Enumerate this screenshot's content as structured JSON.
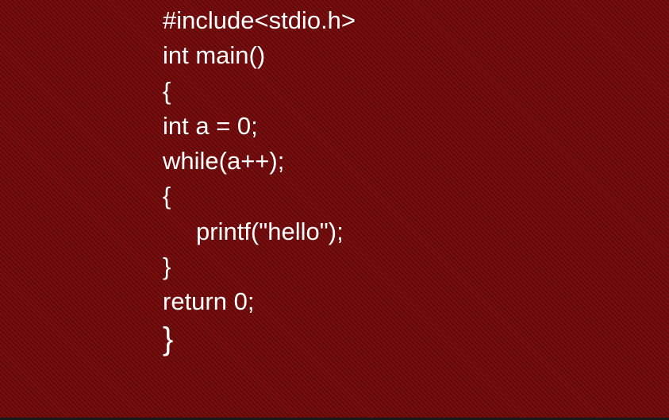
{
  "slide": {
    "background_color": "#7a0d0d",
    "text_color": "#ffffff"
  },
  "code": {
    "lines": [
      "#include<stdio.h>",
      "int main()",
      "{",
      "int a = 0;",
      "while(a++);",
      "{",
      "printf(\"hello\");",
      "}",
      "return 0;",
      "}"
    ]
  }
}
